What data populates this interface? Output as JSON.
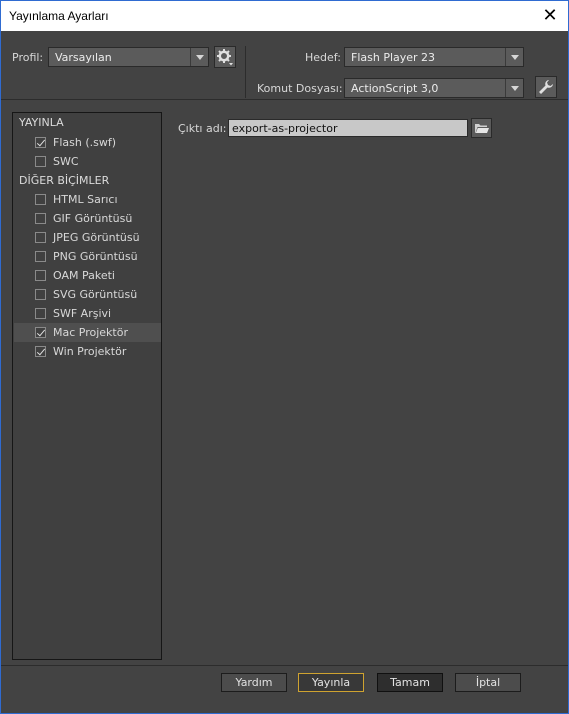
{
  "window": {
    "title": "Yayınlama Ayarları",
    "close_glyph": "✕"
  },
  "header": {
    "profile_label": "Profil:",
    "profile_value": "Varsayılan",
    "target_label": "Hedef:",
    "target_value": "Flash Player 23",
    "script_label": "Komut Dosyası:",
    "script_value": "ActionScript 3,0",
    "profile_settings_icon": "gear-icon",
    "script_settings_icon": "wrench-icon"
  },
  "sidebar": {
    "publish_section": "YAYINLA",
    "publish_items": [
      {
        "label": "Flash (.swf)",
        "checked": true
      },
      {
        "label": "SWC",
        "checked": false
      }
    ],
    "other_section": "DİĞER BİÇİMLER",
    "other_items": [
      {
        "label": "HTML Sarıcı",
        "checked": false
      },
      {
        "label": "GIF Görüntüsü",
        "checked": false
      },
      {
        "label": "JPEG Görüntüsü",
        "checked": false
      },
      {
        "label": "PNG Görüntüsü",
        "checked": false
      },
      {
        "label": "OAM Paketi",
        "checked": false
      },
      {
        "label": "SVG Görüntüsü",
        "checked": false
      },
      {
        "label": "SWF Arşivi",
        "checked": false
      },
      {
        "label": "Mac Projektör",
        "checked": true,
        "selected": true
      },
      {
        "label": "Win Projektör",
        "checked": true
      }
    ]
  },
  "main": {
    "output_label": "Çıktı adı:",
    "output_value": "export-as-projector",
    "browse_icon": "folder-icon"
  },
  "footer": {
    "help": "Yardım",
    "publish": "Yayınla",
    "ok": "Tamam",
    "cancel": "İptal"
  },
  "colors": {
    "background": "#434343",
    "accent_border": "#cfa330",
    "window_border": "#2f6bd1"
  }
}
